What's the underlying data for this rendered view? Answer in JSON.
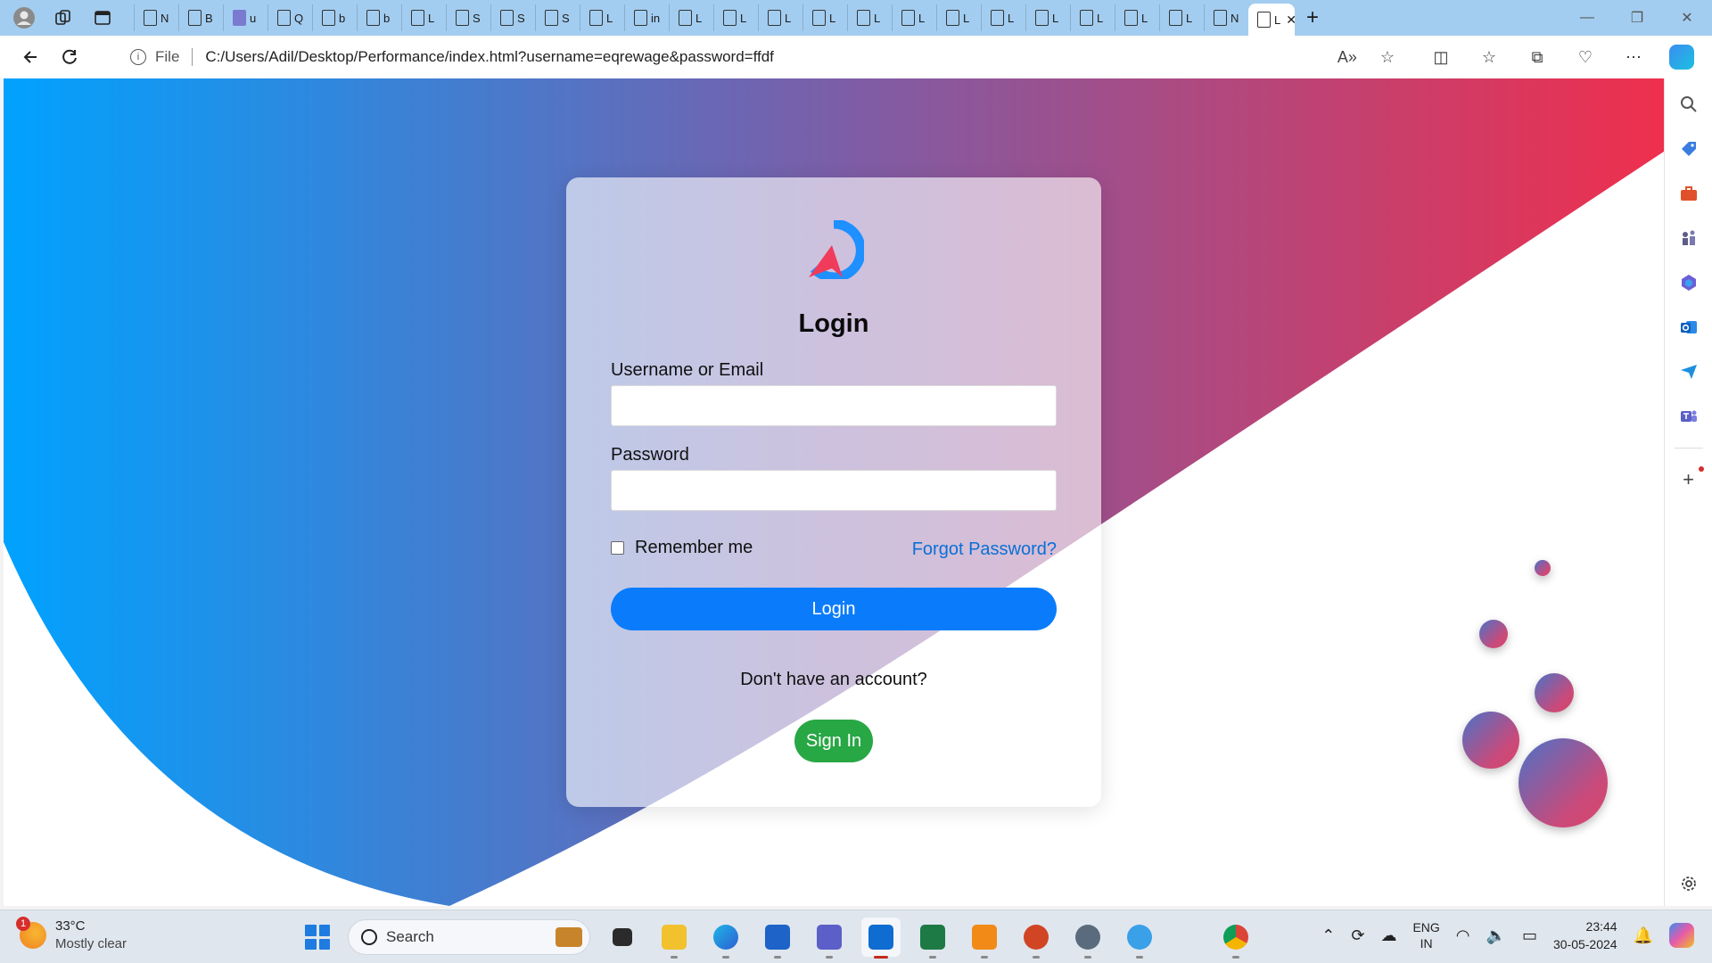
{
  "browser": {
    "tab_labels": [
      "N",
      "B",
      "u",
      "Q",
      "b",
      "b",
      "L",
      "S",
      "S",
      "S",
      "L",
      "in",
      "L",
      "L",
      "L",
      "L",
      "L",
      "L",
      "L",
      "L",
      "L",
      "L",
      "L",
      "L",
      "N",
      "L"
    ],
    "active_tab_label": "L",
    "scheme_label": "File",
    "url": "C:/Users/Adil/Desktop/Performance/index.html?username=eqrewage&password=ffdf"
  },
  "page": {
    "logo_icon": "rocket-logo-icon",
    "title": "Login",
    "username_label": "Username or Email",
    "username_value": "",
    "password_label": "Password",
    "password_value": "",
    "remember_label": "Remember me",
    "forgot_label": "Forgot Password?",
    "login_button": "Login",
    "no_account_text": "Don't have an account?",
    "signin_button": "Sign In",
    "colors": {
      "gradient_start": "#00a2ff",
      "gradient_mid": "#7b5ea8",
      "gradient_end": "#ef2f4d",
      "login_button": "#0a7cfb",
      "signin_button": "#28a745",
      "link": "#0a6fd6"
    }
  },
  "taskbar": {
    "weather_temp": "33°C",
    "weather_desc": "Mostly clear",
    "weather_badge": "1",
    "search_placeholder": "Search",
    "lang_top": "ENG",
    "lang_bottom": "IN",
    "time": "23:44",
    "date": "30-05-2024"
  }
}
